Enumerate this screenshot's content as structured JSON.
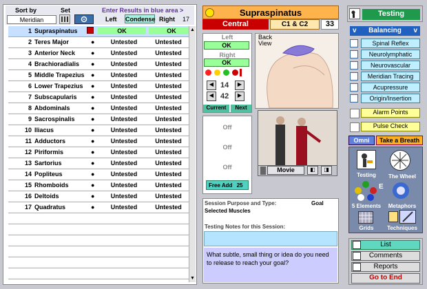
{
  "header": {
    "sort_by": "Sort by",
    "set": "Set",
    "sort_value": "Meridian",
    "enter_results": "Enter Results in blue area >",
    "left": "Left",
    "condense": "Condense",
    "right": "Right",
    "count": "17"
  },
  "muscles": [
    {
      "n": "1",
      "name": "Supraspinatus",
      "left": "OK",
      "right": "OK"
    },
    {
      "n": "2",
      "name": "Teres Major",
      "left": "Untested",
      "right": "Untested"
    },
    {
      "n": "3",
      "name": "Anterior Neck",
      "left": "Untested",
      "right": "Untested"
    },
    {
      "n": "4",
      "name": "Brachioradialis",
      "left": "Untested",
      "right": "Untested"
    },
    {
      "n": "5",
      "name": "Middle Trapezius",
      "left": "Untested",
      "right": "Untested"
    },
    {
      "n": "6",
      "name": "Lower Trapezius",
      "left": "Untested",
      "right": "Untested"
    },
    {
      "n": "7",
      "name": "Subscapularis",
      "left": "Untested",
      "right": "Untested"
    },
    {
      "n": "8",
      "name": "Abdominals",
      "left": "Untested",
      "right": "Untested"
    },
    {
      "n": "9",
      "name": "Sacrospinalis",
      "left": "Untested",
      "right": "Untested"
    },
    {
      "n": "10",
      "name": "Iliacus",
      "left": "Untested",
      "right": "Untested"
    },
    {
      "n": "11",
      "name": "Adductors",
      "left": "Untested",
      "right": "Untested"
    },
    {
      "n": "12",
      "name": "Piriformis",
      "left": "Untested",
      "right": "Untested"
    },
    {
      "n": "13",
      "name": "Sartorius",
      "left": "Untested",
      "right": "Untested"
    },
    {
      "n": "14",
      "name": "Popliteus",
      "left": "Untested",
      "right": "Untested"
    },
    {
      "n": "15",
      "name": "Rhomboids",
      "left": "Untested",
      "right": "Untested"
    },
    {
      "n": "16",
      "name": "Deltoids",
      "left": "Untested",
      "right": "Untested"
    },
    {
      "n": "17",
      "name": "Quadratus",
      "left": "Untested",
      "right": "Untested"
    }
  ],
  "muscle_panel": {
    "title": "Supraspinatus",
    "meridian": "Central",
    "vertebrae": "C1 & C2",
    "number": "33",
    "left_label": "Left",
    "left_value": "OK",
    "right_label": "Right",
    "right_value": "OK",
    "nav_top": "14",
    "nav_bottom": "42",
    "current": "Current",
    "next": "Next",
    "back_view": "Back View",
    "off1": "Off",
    "off2": "Off",
    "off3": "Off",
    "free_add": "Free Add",
    "free_add_count": "25",
    "movie": "Movie"
  },
  "session": {
    "purpose_label": "Session Purpose and Type:",
    "goal": "Goal",
    "selected_muscles": "Selected Muscles",
    "notes_label": "Testing Notes for this Session:",
    "prompt": "What subtle, small thing or idea do you need to release to reach your goal?"
  },
  "right_panel": {
    "testing": "Testing",
    "balancing": "Balancing",
    "items": [
      "Spinal Reflex",
      "Neurolymphatic",
      "Neurovascular",
      "Meridian Tracing",
      "Acupressure",
      "Origin/Insertion"
    ],
    "alarm_points": "Alarm Points",
    "pulse_check": "Pulse Check",
    "omni": "Omni",
    "take_breath": "Take a Breath",
    "icons": [
      "Testing",
      "The Wheel",
      "5 Elements",
      "Metaphors",
      "Grids",
      "Techniques"
    ],
    "list": "List",
    "comments": "Comments",
    "reports": "Reports",
    "go_to_end": "Go to End"
  }
}
